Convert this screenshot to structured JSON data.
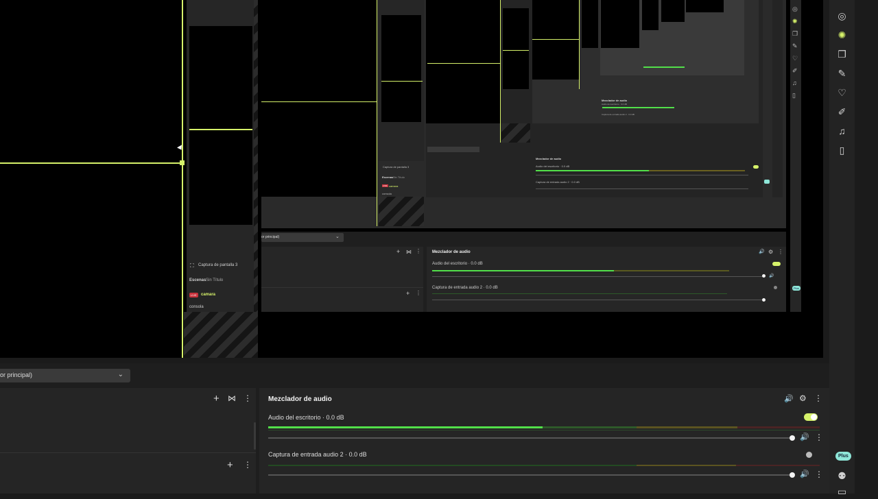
{
  "nested_preview": {
    "level1": {
      "source_item": "Captura de pantalla 3",
      "scenes_label": "Escenas",
      "scenes_value": "Sin Título",
      "live_badge": "LIVE",
      "scene_active": "camara",
      "scene_other": "consola"
    },
    "level2": {
      "dropdown_label": "or principal)",
      "mixer_title": "Mezclador de audio",
      "track1_name": "Audio del escritorio",
      "track1_db": "0.0 dB",
      "track2_name": "Captura de entrada audio 2",
      "track2_db": "0.0 dB",
      "plus_badge": "Plus"
    },
    "level3": {
      "source_item": "Captura de pantalla 3",
      "scenes_label": "Escenas",
      "scenes_value": "Sin Título",
      "live_badge": "LIVE",
      "scene_active": "camara",
      "scene_other": "consola",
      "mixer_title": "Mezclador de audio",
      "track1": "Audio del escritorio · 0.0 dB",
      "track2": "Captura de entrada audio 2 · 0.0 dB"
    }
  },
  "bottom": {
    "dropdown_label": "or principal)",
    "sources_add": "+",
    "filter_icon_glyph": "⋈",
    "more_glyph": "⋮",
    "mixer": {
      "title": "Mezclador de audio",
      "tracks": [
        {
          "name": "Audio del escritorio",
          "db": "0.0 dB",
          "enabled": true
        },
        {
          "name": "Captura de entrada audio 2",
          "db": "0.0 dB",
          "enabled": false
        }
      ]
    },
    "plus_badge": "Plus"
  },
  "rail": {
    "icons": [
      "camera-icon",
      "camera-settings-icon",
      "layers-icon",
      "draw-icon",
      "heart-icon",
      "sticker-icon",
      "music-icon",
      "device-icon"
    ]
  },
  "colors": {
    "accent": "#d6f26a",
    "meter_green": "#52e04a",
    "live_red": "#c8323c",
    "plus_teal": "#8ee6d8"
  }
}
